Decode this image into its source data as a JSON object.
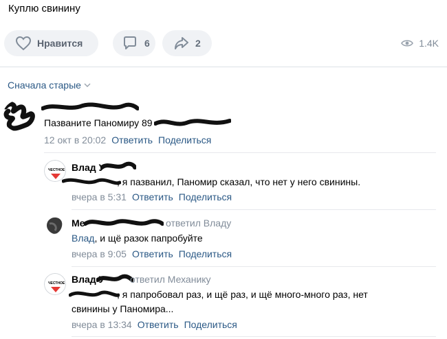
{
  "post": {
    "text": "Куплю свинину"
  },
  "actions": {
    "like_label": "Нравится",
    "comments_count": "6",
    "shares_count": "2",
    "views_count": "1.4K"
  },
  "sort": {
    "label": "Сначала старые"
  },
  "comments": [
    {
      "author": "",
      "text": "Пазваните Паномиру 89",
      "date": "12 окт в 20:02",
      "reply": "Ответить",
      "share": "Поделиться"
    },
    {
      "author": "Влад У",
      "text": ", я пазванил, Паномир сказал, что нет у него свинины.",
      "date": "вчера в 5:31",
      "reply": "Ответить",
      "share": "Поделиться"
    },
    {
      "author": "Ме",
      "reply_to": "ответил Владу",
      "mention": "Влад",
      "text": ", и щё разок папробуйте",
      "date": "вчера в 9:05",
      "reply": "Ответить",
      "share": "Поделиться"
    },
    {
      "author": "Влад У",
      "reply_to": "ответил Механику",
      "text_line1": ", я папробовал раз, и щё раз, и щё много-много раз, нет",
      "text_line2": "свинины у Паномира...",
      "date": "вчера в 13:34",
      "reply": "Ответить",
      "share": "Поделиться"
    }
  ],
  "avatar_badge_text": "ЧЕСТНОЕ"
}
